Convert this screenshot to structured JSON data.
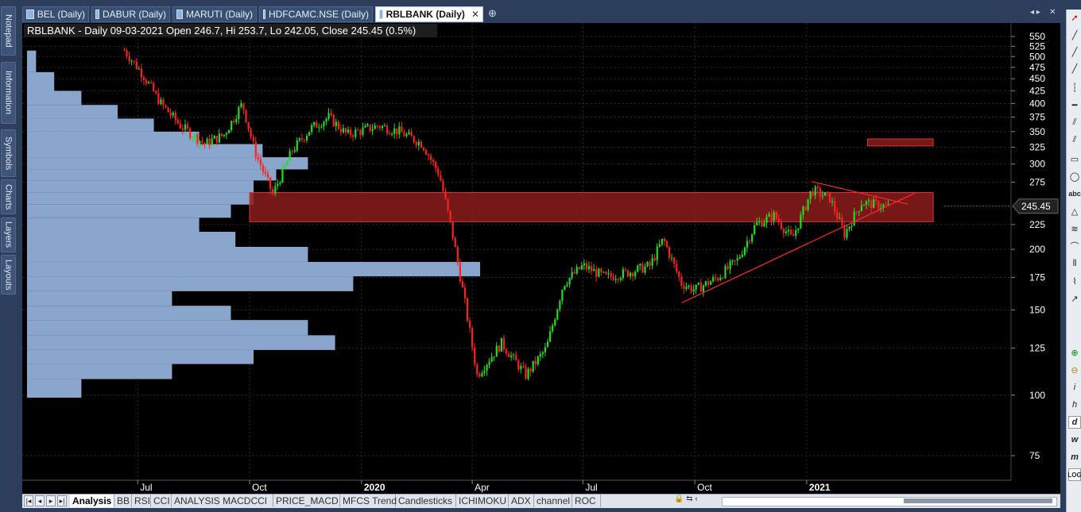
{
  "left_rail": {
    "tabs": [
      "Notepad",
      "Information",
      "Symbols",
      "Charts",
      "Layers",
      "Layouts"
    ]
  },
  "tabs": [
    {
      "label": "BEL (Daily)"
    },
    {
      "label": "DABUR (Daily)"
    },
    {
      "label": "MARUTI (Daily)"
    },
    {
      "label": "HDFCAMC.NSE (Daily)"
    },
    {
      "label": "RBLBANK (Daily)",
      "active": true
    }
  ],
  "tab_close": "✕",
  "tab_add": "⊕",
  "header": {
    "info": "RBLBANK - Daily 09-03-2021 Open 246.7, Hi 253.7, Lo 242.05, Close 245.45 (0.5%)"
  },
  "price_axis": {
    "ticks": [
      "550",
      "525",
      "500",
      "475",
      "450",
      "425",
      "400",
      "375",
      "350",
      "325",
      "300",
      "275",
      "225",
      "200",
      "175",
      "150",
      "125",
      "100",
      "75"
    ],
    "last_price": "245.45"
  },
  "time_axis": {
    "labels": [
      "Jul",
      "Oct",
      "2020",
      "Apr",
      "Jul",
      "Oct",
      "2021"
    ]
  },
  "bottom_tabs": [
    "Analysis",
    "BB",
    "RSI",
    "CCI",
    "ANALYSIS MACDCCI",
    "PRICE_MACD",
    "MFCS Trend",
    "Candlesticks",
    "ICHIMOKU",
    "ADX",
    "channel",
    "ROC"
  ],
  "colors": {
    "up_candle": "#22dd22",
    "down_candle": "#ff2020",
    "volume_profile": "#8aa6cc",
    "zone": "#8b1c1c",
    "trendline": "#ff2a2a"
  },
  "chart_data": {
    "type": "candlestick",
    "symbol": "RBLBANK",
    "scale": "log",
    "y_ticks": [
      550,
      525,
      500,
      475,
      450,
      425,
      400,
      375,
      350,
      325,
      300,
      275,
      225,
      200,
      175,
      150,
      125,
      100,
      75
    ],
    "last_close": 245.45,
    "ohlc_last": {
      "date": "09-03-2021",
      "open": 246.7,
      "high": 253.7,
      "low": 242.05,
      "close": 245.45,
      "change_pct": 0.5
    },
    "path_points": [
      {
        "t": "2019-06-20",
        "p": 515
      },
      {
        "t": "2019-07-05",
        "p": 460
      },
      {
        "t": "2019-07-20",
        "p": 400
      },
      {
        "t": "2019-08-05",
        "p": 360
      },
      {
        "t": "2019-08-25",
        "p": 330
      },
      {
        "t": "2019-09-10",
        "p": 345
      },
      {
        "t": "2019-09-25",
        "p": 400
      },
      {
        "t": "2019-10-05",
        "p": 320
      },
      {
        "t": "2019-10-20",
        "p": 260
      },
      {
        "t": "2019-11-05",
        "p": 320
      },
      {
        "t": "2019-11-20",
        "p": 355
      },
      {
        "t": "2019-12-05",
        "p": 375
      },
      {
        "t": "2019-12-20",
        "p": 345
      },
      {
        "t": "2020-01-15",
        "p": 360
      },
      {
        "t": "2020-02-01",
        "p": 350
      },
      {
        "t": "2020-02-20",
        "p": 330
      },
      {
        "t": "2020-03-05",
        "p": 285
      },
      {
        "t": "2020-03-15",
        "p": 220
      },
      {
        "t": "2020-03-25",
        "p": 160
      },
      {
        "t": "2020-04-05",
        "p": 110
      },
      {
        "t": "2020-04-25",
        "p": 128
      },
      {
        "t": "2020-05-15",
        "p": 110
      },
      {
        "t": "2020-06-01",
        "p": 125
      },
      {
        "t": "2020-06-15",
        "p": 170
      },
      {
        "t": "2020-07-01",
        "p": 185
      },
      {
        "t": "2020-07-20",
        "p": 175
      },
      {
        "t": "2020-08-10",
        "p": 180
      },
      {
        "t": "2020-08-25",
        "p": 185
      },
      {
        "t": "2020-09-05",
        "p": 210
      },
      {
        "t": "2020-09-20",
        "p": 170
      },
      {
        "t": "2020-10-01",
        "p": 165
      },
      {
        "t": "2020-10-20",
        "p": 175
      },
      {
        "t": "2020-11-05",
        "p": 190
      },
      {
        "t": "2020-11-20",
        "p": 225
      },
      {
        "t": "2020-12-05",
        "p": 235
      },
      {
        "t": "2020-12-20",
        "p": 210
      },
      {
        "t": "2021-01-05",
        "p": 265
      },
      {
        "t": "2021-01-20",
        "p": 255
      },
      {
        "t": "2021-02-01",
        "p": 215
      },
      {
        "t": "2021-02-15",
        "p": 250
      },
      {
        "t": "2021-03-09",
        "p": 245
      }
    ],
    "zones": [
      {
        "name": "support-zone",
        "from": "2019-10-01",
        "to": "2021-04-15",
        "low": 228,
        "high": 262
      },
      {
        "name": "resistance-zone",
        "from": "2021-02-20",
        "to": "2021-04-15",
        "low": 327,
        "high": 338
      }
    ],
    "trendlines": [
      {
        "from": {
          "t": "2020-09-20",
          "p": 155
        },
        "to": {
          "t": "2021-04-01",
          "p": 262
        }
      },
      {
        "from": {
          "t": "2021-01-05",
          "p": 276
        },
        "to": {
          "t": "2021-03-25",
          "p": 248
        }
      }
    ],
    "volume_profile_levels": [
      {
        "p": 490,
        "v": 0.02
      },
      {
        "p": 440,
        "v": 0.06
      },
      {
        "p": 410,
        "v": 0.12
      },
      {
        "p": 385,
        "v": 0.2
      },
      {
        "p": 360,
        "v": 0.28
      },
      {
        "p": 340,
        "v": 0.38
      },
      {
        "p": 320,
        "v": 0.52
      },
      {
        "p": 300,
        "v": 0.62
      },
      {
        "p": 285,
        "v": 0.55
      },
      {
        "p": 270,
        "v": 0.5
      },
      {
        "p": 255,
        "v": 0.5
      },
      {
        "p": 240,
        "v": 0.45
      },
      {
        "p": 225,
        "v": 0.38
      },
      {
        "p": 210,
        "v": 0.46
      },
      {
        "p": 195,
        "v": 0.62
      },
      {
        "p": 182,
        "v": 1.0
      },
      {
        "p": 170,
        "v": 0.72
      },
      {
        "p": 158,
        "v": 0.32
      },
      {
        "p": 148,
        "v": 0.45
      },
      {
        "p": 138,
        "v": 0.62
      },
      {
        "p": 128,
        "v": 0.68
      },
      {
        "p": 120,
        "v": 0.5
      },
      {
        "p": 112,
        "v": 0.32
      },
      {
        "p": 104,
        "v": 0.12
      }
    ]
  }
}
